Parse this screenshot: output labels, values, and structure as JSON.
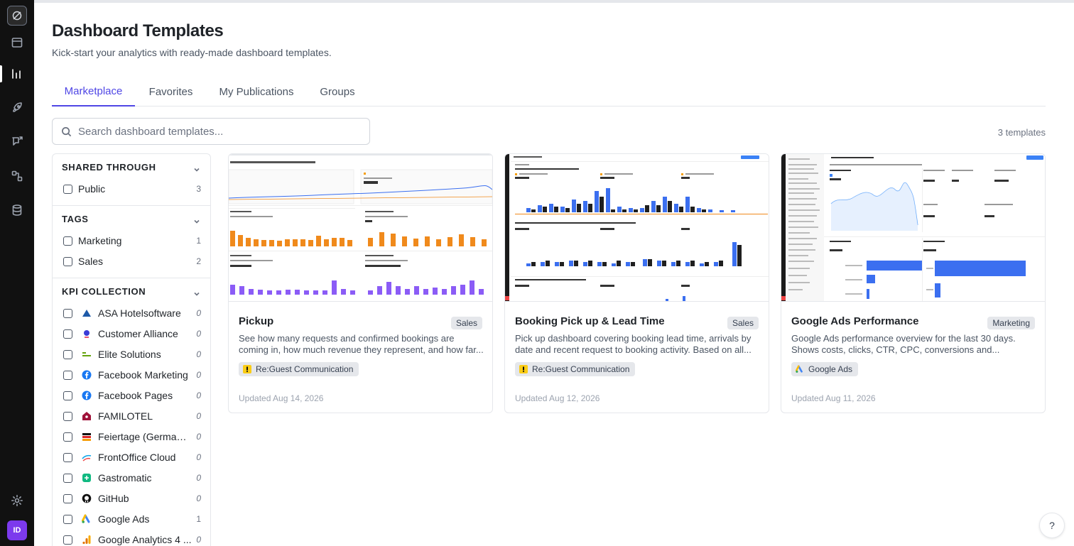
{
  "header": {
    "title": "Dashboard Templates",
    "subtitle": "Kick-start your analytics with ready-made dashboard templates."
  },
  "tabs": [
    {
      "label": "Marketplace",
      "active": true
    },
    {
      "label": "Favorites",
      "active": false
    },
    {
      "label": "My Publications",
      "active": false
    },
    {
      "label": "Groups",
      "active": false
    }
  ],
  "search": {
    "placeholder": "Search dashboard templates...",
    "value": ""
  },
  "results_count": "3 templates",
  "filters": {
    "shared": {
      "title": "SHARED THROUGH",
      "items": [
        {
          "label": "Public",
          "count": "3"
        }
      ]
    },
    "tags": {
      "title": "TAGS",
      "items": [
        {
          "label": "Marketing",
          "count": "1"
        },
        {
          "label": "Sales",
          "count": "2"
        }
      ]
    },
    "kpi": {
      "title": "KPI COLLECTION",
      "items": [
        {
          "label": "ASA Hotelsoftware",
          "count": "0",
          "icon": "asa-logo-icon"
        },
        {
          "label": "Customer Alliance",
          "count": "0",
          "icon": "customer-alliance-logo-icon"
        },
        {
          "label": "Elite Solutions",
          "count": "0",
          "icon": "elite-solutions-logo-icon"
        },
        {
          "label": "Facebook Marketing",
          "count": "0",
          "icon": "facebook-icon"
        },
        {
          "label": "Facebook Pages",
          "count": "0",
          "icon": "facebook-icon"
        },
        {
          "label": "FAMILOTEL",
          "count": "0",
          "icon": "familotel-logo-icon"
        },
        {
          "label": "Feiertage (German ...",
          "count": "0",
          "icon": "calendar-icon"
        },
        {
          "label": "FrontOffice Cloud",
          "count": "0",
          "icon": "frontoffice-logo-icon"
        },
        {
          "label": "Gastromatic",
          "count": "0",
          "icon": "gastromatic-logo-icon"
        },
        {
          "label": "GitHub",
          "count": "0",
          "icon": "github-icon"
        },
        {
          "label": "Google Ads",
          "count": "1",
          "icon": "google-ads-icon"
        },
        {
          "label": "Google Analytics 4 ...",
          "count": "0",
          "icon": "google-analytics-icon"
        }
      ]
    }
  },
  "cards": [
    {
      "title": "Pickup",
      "tag": "Sales",
      "description": "See how many requests and confirmed bookings are coming in, how much revenue they represent, and how far...",
      "source": "Re:Guest Communication",
      "updated": "Updated Aug 14, 2026"
    },
    {
      "title": "Booking Pick up & Lead Time",
      "tag": "Sales",
      "description": "Pick up dashboard covering booking lead time, arrivals by date and recent request to booking activity. Based on all...",
      "source": "Re:Guest Communication",
      "updated": "Updated Aug 12, 2026"
    },
    {
      "title": "Google Ads Performance",
      "tag": "Marketing",
      "description": "Google Ads performance overview for the last 30 days. Shows costs, clicks, CTR, CPC, conversions and...",
      "source": "Google Ads",
      "updated": "Updated Aug 11, 2026"
    }
  ],
  "colors": {
    "accent": "#4f46e5",
    "bars_orange": "#f08a1c",
    "bars_purple": "#8b5cf6",
    "bars_blue": "#3b6ff0",
    "user_avatar": "#7c3aed"
  },
  "user": {
    "initials": "ID"
  },
  "help_label": "?"
}
